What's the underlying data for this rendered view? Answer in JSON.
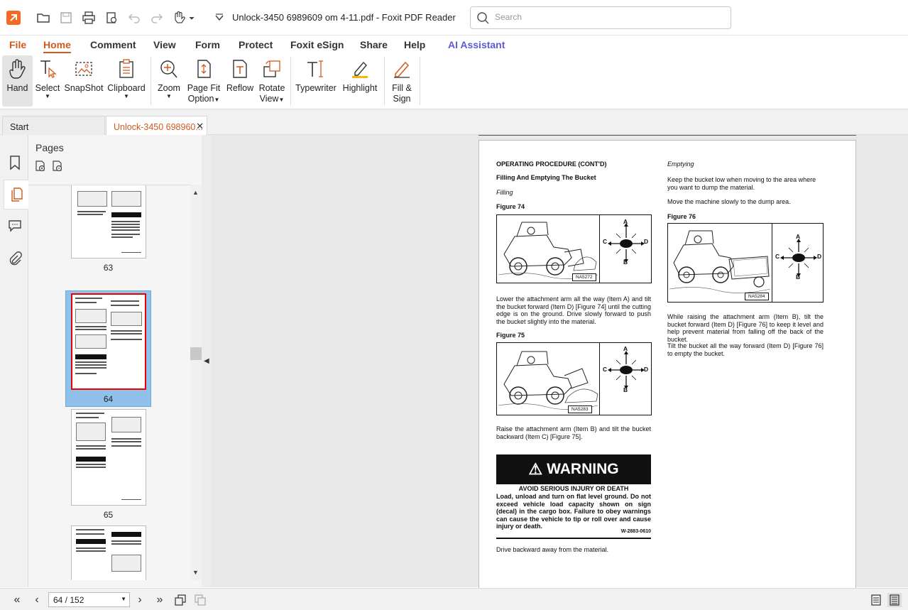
{
  "window": {
    "title": "Unlock-3450 6989609 om 4-11.pdf - Foxit PDF Reader",
    "search_placeholder": "Search"
  },
  "menu": [
    "File",
    "Home",
    "Comment",
    "View",
    "Form",
    "Protect",
    "Foxit eSign",
    "Share",
    "Help",
    "AI Assistant"
  ],
  "ribbon": {
    "hand": "Hand",
    "select": "Select",
    "snapshot": "SnapShot",
    "clipboard": "Clipboard",
    "zoom": "Zoom",
    "page_fit_1": "Page Fit",
    "page_fit_2": "Option",
    "reflow": "Reflow",
    "rotate_1": "Rotate",
    "rotate_2": "View",
    "typewriter": "Typewriter",
    "highlight": "Highlight",
    "fill_1": "Fill &",
    "fill_2": "Sign"
  },
  "tabs": {
    "start": "Start",
    "doc": "Unlock-3450 698960..."
  },
  "pages_panel": {
    "title": "Pages",
    "thumbs": [
      "63",
      "64",
      "65"
    ]
  },
  "pdf": {
    "heading": "OPERATING PROCEDURE (CONT'D)",
    "subheading": "Filling And Emptying The Bucket",
    "filling": "Filling",
    "fig74": "Figure 74",
    "fig74_code": "NA5272",
    "para1": "Lower the attachment arm all the way (Item A) and tilt the bucket forward (Item D) [Figure 74] until the cutting edge is on the ground. Drive slowly forward to push the bucket slightly into the material.",
    "fig75": "Figure 75",
    "fig75_code": "NA5283",
    "para2": "Raise the attachment arm (Item B) and tilt the bucket backward (Item C) [Figure 75].",
    "warning": "WARNING",
    "warn_head": "AVOID SERIOUS INJURY OR DEATH",
    "warn_text": "Load, unload and turn on flat level ground. Do not exceed vehicle load capacity shown on sign (decal) in the cargo box. Failure to obey warnings can cause the vehicle to tip or roll over and cause injury or death.",
    "warn_code": "W-2883-0610",
    "para3": "Drive backward away from the material.",
    "emptying": "Emptying",
    "para4": "Keep the bucket low when moving to the area where you want to dump the material.",
    "para5": "Move the machine slowly to the dump area.",
    "fig76": "Figure 76",
    "fig76_code": "NA5284",
    "para6": "While raising the attachment arm (Item B), tilt the bucket forward (Item D) [Figure 76] to keep it level and help prevent material from falling off the back of the bucket.",
    "para7": "Tilt the bucket all the way forward (Item D) [Figure 76] to empty the bucket.",
    "dir_a": "A",
    "dir_b": "B",
    "dir_c": "C",
    "dir_d": "D"
  },
  "status": {
    "page_indicator": "64 / 152"
  }
}
